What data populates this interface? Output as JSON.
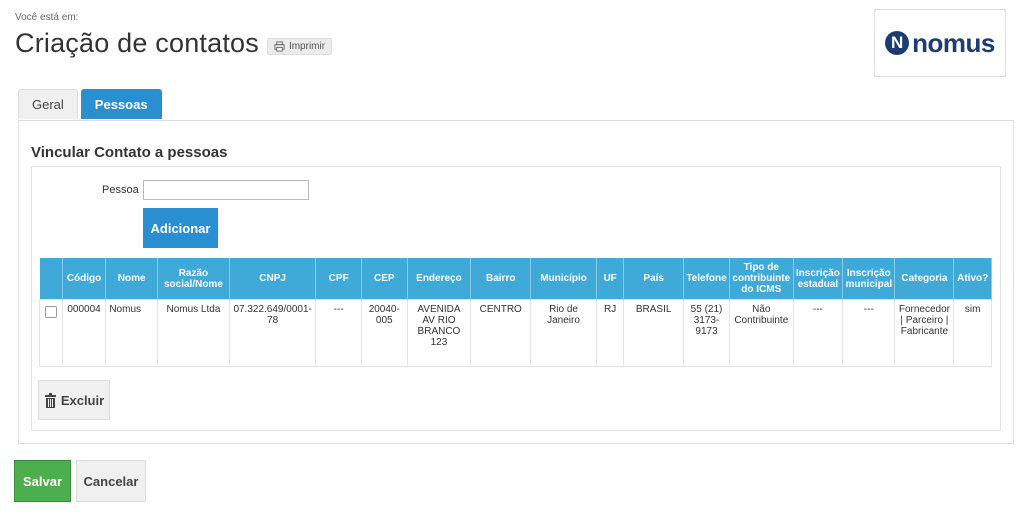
{
  "header": {
    "breadcrumb_label": "Você está em:",
    "title": "Criação de contatos",
    "print_label": "Imprimir",
    "logo_text": "nomus",
    "logo_mark": "N"
  },
  "tabs": [
    {
      "label": "Geral",
      "active": false
    },
    {
      "label": "Pessoas",
      "active": true
    }
  ],
  "section": {
    "title": "Vincular Contato a pessoas",
    "pessoa_label": "Pessoa",
    "pessoa_value": "",
    "add_label": "Adicionar"
  },
  "table": {
    "headers": [
      "",
      "Código",
      "Nome",
      "Razão social/Nome",
      "CNPJ",
      "CPF",
      "CEP",
      "Endereço",
      "Bairro",
      "Município",
      "UF",
      "País",
      "Telefone",
      "Tipo de contribuinte do ICMS",
      "Inscrição estadual",
      "Inscrição municipal",
      "Categoria",
      "Ativo?"
    ],
    "rows": [
      [
        "",
        "000004",
        "Nomus",
        "Nomus Ltda",
        "07.322.649/0001-78",
        "---",
        "20040-005",
        "AVENIDA AV RIO BRANCO 123",
        "CENTRO",
        "Rio de Janeiro",
        "RJ",
        "BRASIL",
        "55 (21) 3173-9173",
        "Não Contribuinte",
        "---",
        "---",
        "Fornecedor | Parceiro | Fabricante",
        "sim"
      ]
    ]
  },
  "actions": {
    "delete_label": "Excluir",
    "save_label": "Salvar",
    "cancel_label": "Cancelar"
  },
  "colors": {
    "primary": "#2a8fd0",
    "table_header": "#3fa9d8",
    "success": "#4cae4c",
    "logo": "#1f3b73"
  },
  "icons": {
    "print": "printer-icon",
    "delete": "trash-icon"
  }
}
